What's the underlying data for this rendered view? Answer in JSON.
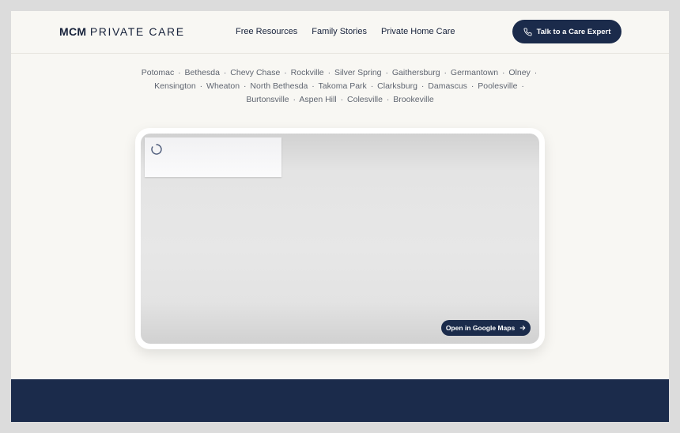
{
  "header": {
    "logo_bold": "MCM",
    "logo_light": "PRIVATE CARE",
    "nav": [
      {
        "label": "Free Resources"
      },
      {
        "label": "Family Stories"
      },
      {
        "label": "Private Home Care"
      }
    ],
    "cta_label": "Talk to a Care Expert"
  },
  "service_area": {
    "cities": [
      "Potomac",
      "Bethesda",
      "Chevy Chase",
      "Rockville",
      "Silver Spring",
      "Gaithersburg",
      "Germantown",
      "Olney",
      "Kensington",
      "Wheaton",
      "North Bethesda",
      "Takoma Park",
      "Clarksburg",
      "Damascus",
      "Poolesville",
      "Burtonsville",
      "Aspen Hill",
      "Colesville",
      "Brookeville"
    ],
    "separator": "·"
  },
  "map": {
    "open_button_label": "Open in Google Maps"
  },
  "colors": {
    "navy": "#1b2b4b",
    "page_bg": "#f8f7f3",
    "text_muted": "#5f6570"
  },
  "icons": {
    "cta": "phone-icon",
    "open_maps": "arrow-right-icon",
    "loading": "spinner-icon"
  }
}
